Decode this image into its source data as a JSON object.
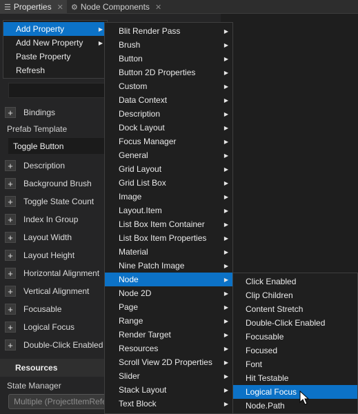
{
  "tabs": [
    {
      "label": "Properties",
      "icon": "properties-icon",
      "close": "✕"
    },
    {
      "label": "Node Components",
      "icon": "components-icon",
      "close": "✕"
    }
  ],
  "panel": {
    "bindings_label": "Bindings",
    "prefab_template_label": "Prefab Template",
    "prefab_template_value": "Toggle Button",
    "properties": [
      "Description",
      "Background Brush",
      "Toggle State Count",
      "Index In Group",
      "Layout Width",
      "Layout Height",
      "Horizontal Alignment",
      "Vertical Alignment",
      "Focusable",
      "Logical Focus",
      "Double-Click Enabled"
    ],
    "resources_header": "Resources",
    "state_manager_label": "State Manager",
    "state_manager_value": "Multiple (ProjectItemRefe"
  },
  "context_menu": {
    "items": [
      "Add Property",
      "Add New Property",
      "Paste Property",
      "Refresh"
    ],
    "highlighted": "Add Property"
  },
  "property_menu": {
    "items": [
      "Blit Render Pass",
      "Brush",
      "Button",
      "Button 2D Properties",
      "Custom",
      "Data Context",
      "Description",
      "Dock Layout",
      "Focus Manager",
      "General",
      "Grid Layout",
      "Grid List Box",
      "Image",
      "Layout.Item",
      "List Box Item Container",
      "List Box Item Properties",
      "Material",
      "Nine Patch Image",
      "Node",
      "Node 2D",
      "Page",
      "Range",
      "Render Target",
      "Resources",
      "Scroll View 2D Properties",
      "Slider",
      "Stack Layout",
      "Text Block"
    ],
    "highlighted": "Node"
  },
  "node_menu": {
    "items": [
      "Click Enabled",
      "Clip Children",
      "Content Stretch",
      "Double-Click Enabled",
      "Focusable",
      "Focused",
      "Font",
      "Hit Testable",
      "Logical Focus",
      "Node.Path"
    ],
    "highlighted": "Logical Focus"
  },
  "colors": {
    "highlight": "#0c72c7",
    "menu_background": "#1f1f1f",
    "panel_background": "#252526"
  }
}
